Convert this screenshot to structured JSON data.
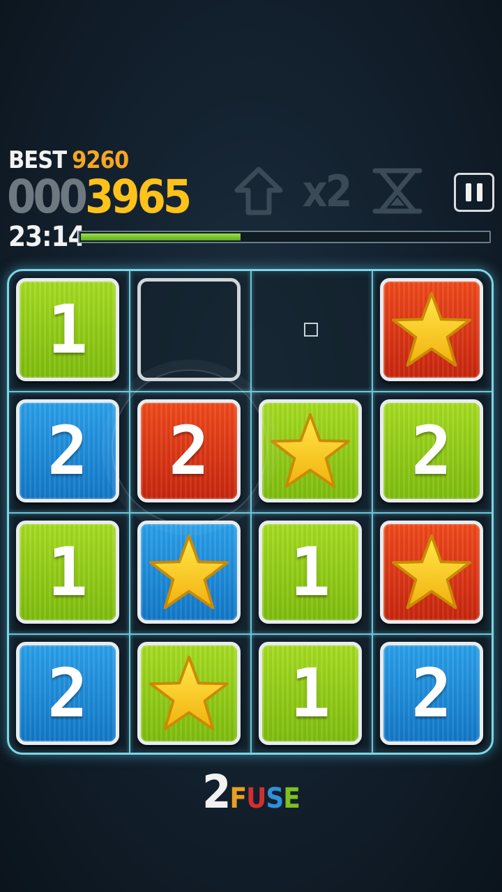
{
  "hud": {
    "best_label": "BEST",
    "best_value": "9260",
    "score_pad": "000",
    "score_value": "3965",
    "timer": "23:14",
    "time_progress": 0.39
  },
  "powerups": [
    {
      "name": "arrow-up-icon"
    },
    {
      "name": "multiplier",
      "label": "x2"
    },
    {
      "name": "hourglass-icon"
    }
  ],
  "pause_icon": "pause-icon",
  "board": {
    "rows": 4,
    "cols": 4,
    "cells": [
      [
        {
          "color": "green",
          "glyph": "1"
        },
        {
          "color": "empty",
          "glyph": ""
        },
        {
          "color": "none",
          "glyph": ""
        },
        {
          "color": "red",
          "glyph": "star"
        }
      ],
      [
        {
          "color": "blue",
          "glyph": "2"
        },
        {
          "color": "red",
          "glyph": "2"
        },
        {
          "color": "green",
          "glyph": "star"
        },
        {
          "color": "green",
          "glyph": "2"
        }
      ],
      [
        {
          "color": "green",
          "glyph": "1"
        },
        {
          "color": "blue",
          "glyph": "star"
        },
        {
          "color": "green",
          "glyph": "1"
        },
        {
          "color": "red",
          "glyph": "star"
        }
      ],
      [
        {
          "color": "blue",
          "glyph": "2"
        },
        {
          "color": "green",
          "glyph": "star"
        },
        {
          "color": "green",
          "glyph": "1"
        },
        {
          "color": "blue",
          "glyph": "2"
        }
      ]
    ]
  },
  "logo": {
    "two": "2",
    "letters": [
      {
        "ch": "F",
        "color": "#e8a020"
      },
      {
        "ch": "U",
        "color": "#d03030"
      },
      {
        "ch": "S",
        "color": "#3090d8"
      },
      {
        "ch": "E",
        "color": "#7fc020"
      }
    ]
  },
  "colors": {
    "accent": "#f5a623",
    "score": "#ffc21a",
    "grid_glow": "#7fd6e6",
    "timer_fill": "#7fc828"
  }
}
